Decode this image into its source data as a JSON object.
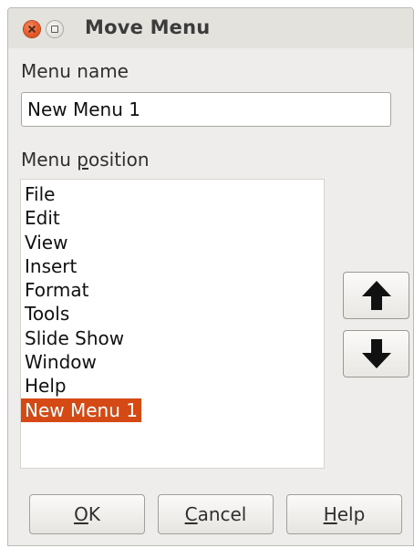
{
  "window": {
    "title": "Move Menu",
    "controls": [
      "close-icon",
      "maximize-icon"
    ]
  },
  "menu_name": {
    "label": "Menu name",
    "value": "New Menu 1"
  },
  "menu_position": {
    "label_prefix": "Menu ",
    "label_mnemonic": "p",
    "label_suffix": "osition",
    "items": [
      {
        "label": "File",
        "selected": false
      },
      {
        "label": "Edit",
        "selected": false
      },
      {
        "label": "View",
        "selected": false
      },
      {
        "label": "Insert",
        "selected": false
      },
      {
        "label": "Format",
        "selected": false
      },
      {
        "label": "Tools",
        "selected": false
      },
      {
        "label": "Slide Show",
        "selected": false
      },
      {
        "label": "Window",
        "selected": false
      },
      {
        "label": "Help",
        "selected": false
      },
      {
        "label": "New Menu 1",
        "selected": true
      }
    ],
    "move_up_icon": "arrow-up-icon",
    "move_down_icon": "arrow-down-icon"
  },
  "buttons": {
    "ok": {
      "mnemonic": "O",
      "rest": "K"
    },
    "cancel": {
      "mnemonic": "C",
      "rest": "ancel"
    },
    "help": {
      "mnemonic": "H",
      "rest": "elp"
    }
  },
  "colors": {
    "selection": "#d54a14",
    "close_button": "#e85a2c",
    "dialog_bg": "#efedeb"
  }
}
